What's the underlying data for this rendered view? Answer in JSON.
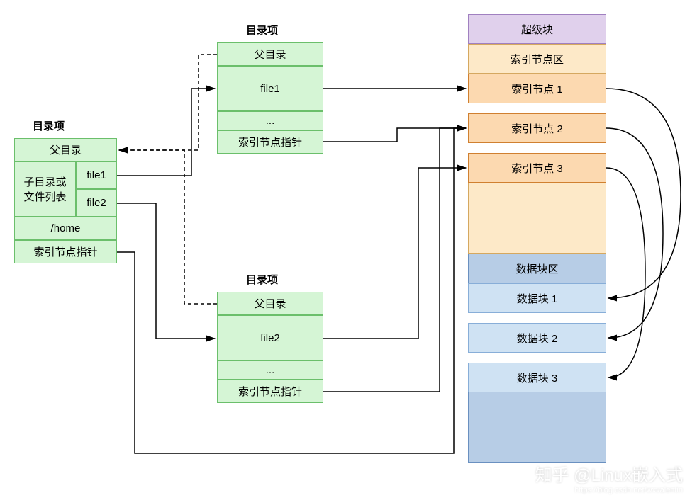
{
  "leftDir": {
    "title": "目录项",
    "parent": "父目录",
    "sublistLabel": "子目录或\n文件列表",
    "file1": "file1",
    "file2": "file2",
    "path": "/home",
    "inodePtr": "索引节点指针"
  },
  "topDir": {
    "title": "目录项",
    "parent": "父目录",
    "file": "file1",
    "ellipsis": "...",
    "inodePtr": "索引节点指针"
  },
  "bottomDir": {
    "title": "目录项",
    "parent": "父目录",
    "file": "file2",
    "ellipsis": "...",
    "inodePtr": "索引节点指针"
  },
  "disk": {
    "superblock": "超级块",
    "inodeArea": "索引节点区",
    "inode1": "索引节点 1",
    "inode2": "索引节点 2",
    "inode3": "索引节点 3",
    "dataArea": "数据块区",
    "data1": "数据块 1",
    "data2": "数据块 2",
    "data3": "数据块 3"
  },
  "watermark": {
    "main": "知乎 @Linux嵌入式",
    "sub": "https://blog.csdn.net/wxvalentin"
  }
}
